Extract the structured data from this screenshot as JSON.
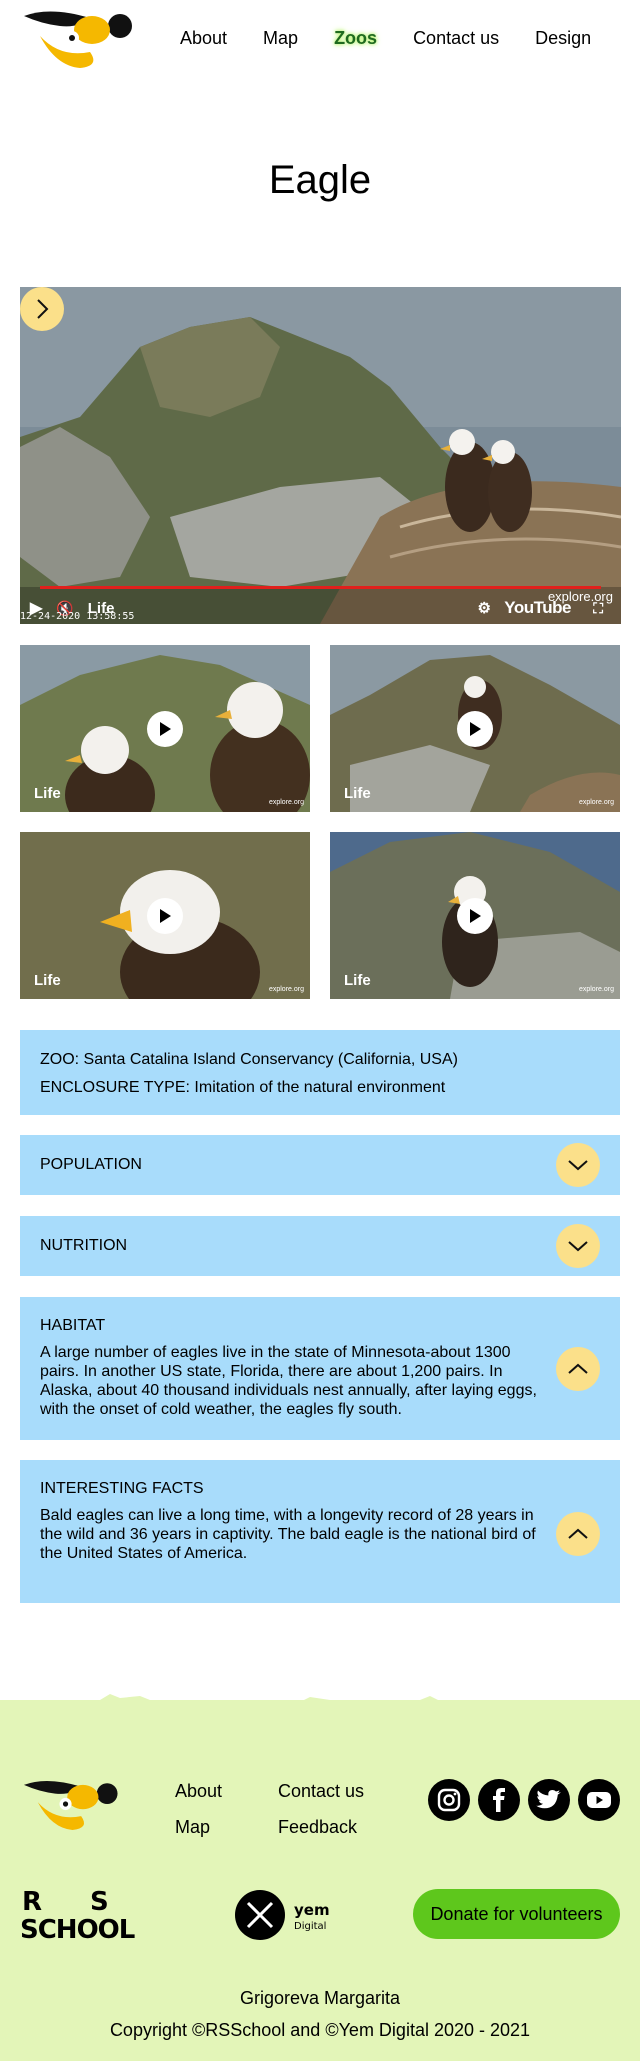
{
  "header": {
    "nav": [
      {
        "label": "About"
      },
      {
        "label": "Map"
      },
      {
        "label": "Zoos",
        "active": true
      },
      {
        "label": "Contact us"
      },
      {
        "label": "Design"
      }
    ],
    "accent_color": "#fbe08a"
  },
  "page_title": "Eagle",
  "main_video": {
    "live_label": "Life",
    "timestamp": "12-24-2020 13:58:55",
    "watermark": "explore.org",
    "player": "YouTube"
  },
  "thumbnails": [
    {
      "live_label": "Life",
      "watermark": "explore.org"
    },
    {
      "live_label": "Life",
      "watermark": "explore.org"
    },
    {
      "live_label": "Life",
      "watermark": "explore.org"
    },
    {
      "live_label": "Life",
      "watermark": "explore.org"
    }
  ],
  "info": {
    "zoo": "ZOO: Santa Catalina Island Conservancy (California, USA)",
    "enclosure": "ENCLOSURE TYPE: Imitation of the natural environment",
    "population_title": "POPULATION",
    "nutrition_title": "NUTRITION",
    "habitat_title": "HABITAT",
    "habitat_lines": [
      "A large number of eagles live in the state of Minnesota-about 1300",
      "pairs. In another US state, Florida, there are about 1,200 pairs. In",
      "Alaska, about 40 thousand individuals nest annually, after laying eggs,",
      "with the onset of cold weather, the eagles fly south."
    ],
    "facts_title": "INTERESTING FACTS",
    "facts_lines": [
      "Bald eagles can live a long time, with a longevity record of 28 years in",
      "the wild and 36 years in captivity. The bald eagle is the national bird of",
      "the United States of America."
    ],
    "panel_color": "#a8dcfb"
  },
  "footer": {
    "links": {
      "about": "About",
      "map": "Map",
      "contact": "Contact us",
      "feedback": "Feedback"
    },
    "social": [
      "instagram-icon",
      "facebook-icon",
      "twitter-icon",
      "youtube-icon"
    ],
    "rs_logo_text": {
      "r": "R",
      "s": "S",
      "school": "SCHOOL"
    },
    "yem_logo_text": {
      "line1": "yem",
      "line2": "Digital"
    },
    "donate_label": "Donate for volunteers",
    "author": "Grigoreva Margarita",
    "copyright": "Copyright ©RSSchool and ©Yem Digital 2020 - 2021",
    "background": "#e3f5b8",
    "donate_color": "#5ec71c"
  }
}
